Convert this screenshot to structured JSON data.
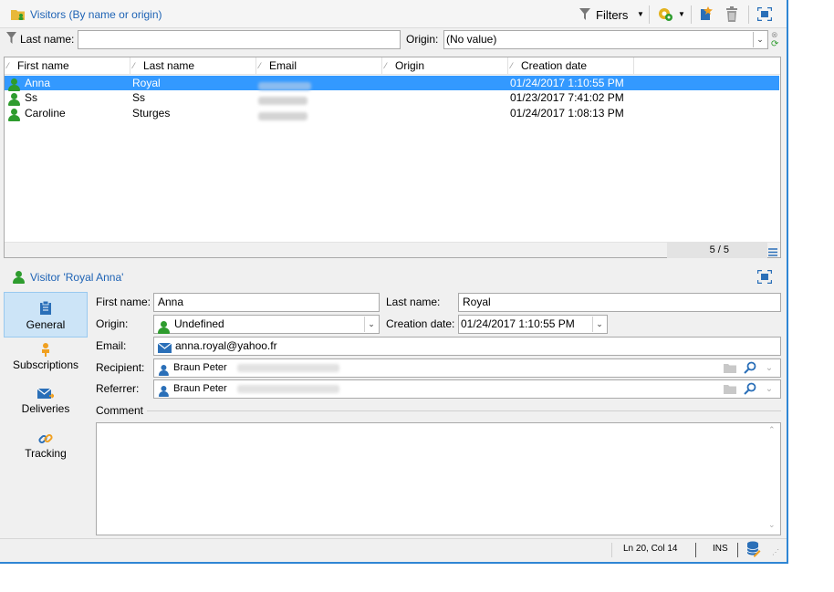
{
  "window": {
    "title": "Visitors (By name or origin)"
  },
  "toolbar": {
    "filters_label": "Filters"
  },
  "filter_bar": {
    "last_name_label": "Last name:",
    "last_name_value": "",
    "origin_label": "Origin:",
    "origin_value": "(No value)"
  },
  "grid": {
    "columns": [
      "First name",
      "Last name",
      "Email",
      "Origin",
      "Creation date"
    ],
    "rows": [
      {
        "first_name": "Anna",
        "last_name": "Royal",
        "creation_date": "01/24/2017 1:10:55 PM",
        "selected": true
      },
      {
        "first_name": "Ss",
        "last_name": "Ss",
        "creation_date": "01/23/2017 7:41:02 PM",
        "selected": false
      },
      {
        "first_name": "Caroline",
        "last_name": "Sturges",
        "creation_date": "01/24/2017 1:08:13 PM",
        "selected": false
      }
    ],
    "count": "5 / 5"
  },
  "detail": {
    "title": "Visitor 'Royal Anna'",
    "sidebar": [
      {
        "label": "General",
        "icon": "clipboard-icon",
        "active": true
      },
      {
        "label": "Subscriptions",
        "icon": "subscription-icon",
        "active": false
      },
      {
        "label": "Deliveries",
        "icon": "envelope-icon",
        "active": false
      },
      {
        "label": "Tracking",
        "icon": "link-icon",
        "active": false
      }
    ],
    "form": {
      "first_name_label": "First name:",
      "first_name_value": "Anna",
      "last_name_label": "Last name:",
      "last_name_value": "Royal",
      "origin_label": "Origin:",
      "origin_value": "Undefined",
      "creation_date_label": "Creation date:",
      "creation_date_value": "01/24/2017 1:10:55 PM",
      "email_label": "Email:",
      "email_value": "anna.royal@yahoo.fr",
      "recipient_label": "Recipient:",
      "recipient_value": "Braun Peter",
      "referrer_label": "Referrer:",
      "referrer_value": "Braun Peter",
      "comment_label": "Comment",
      "comment_value": ""
    }
  },
  "statusbar": {
    "position": "Ln 20, Col 14",
    "mode": "INS"
  },
  "colors": {
    "accent": "#1e63b5",
    "selection": "#3399ff",
    "frame": "#2f86d4"
  }
}
